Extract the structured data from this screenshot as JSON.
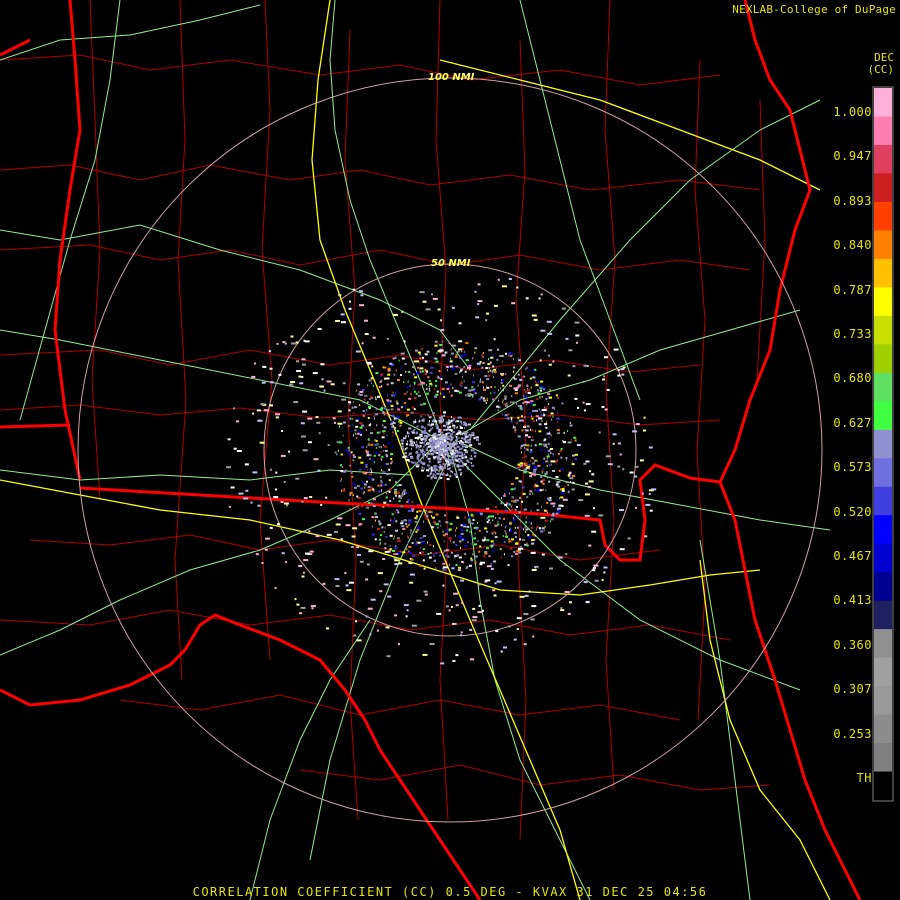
{
  "credit": "NEXLAB-College of DuPage",
  "product": {
    "line1": "DEC",
    "line2": "(CC)"
  },
  "legend": {
    "labels": [
      "1.000",
      "0.947",
      "0.893",
      "0.840",
      "0.787",
      "0.733",
      "0.680",
      "0.627",
      "0.573",
      "0.520",
      "0.467",
      "0.413",
      "0.360",
      "0.307",
      "0.253",
      "TH"
    ],
    "colors": [
      "#ffb0d8",
      "#ff80b0",
      "#e04060",
      "#cc2020",
      "#ff4000",
      "#ff8000",
      "#ffc000",
      "#ffff00",
      "#c8e000",
      "#a0d000",
      "#60e060",
      "#40ff40",
      "#9090d0",
      "#7070e0",
      "#4040e0",
      "#0000ff",
      "#0000d0",
      "#000090",
      "#202060",
      "#909090",
      "#a0a0a0",
      "#999999",
      "#8c8c8c",
      "#808080",
      "#000000"
    ]
  },
  "rings": [
    {
      "label": "100 NMI",
      "radius_nmi": 100
    },
    {
      "label": "50 NMI",
      "radius_nmi": 50
    }
  ],
  "title": "CORRELATION COEFFICIENT (CC) 0.5 DEG - KVAX 31 DEC 25 04:56",
  "colors": {
    "state_border": "#ff0000",
    "county_border": "#b00000",
    "highway_interstate": "#ffff00",
    "highway_other": "#90ee90",
    "text": "#e6e600",
    "range_ring": "#d4a0a0"
  }
}
